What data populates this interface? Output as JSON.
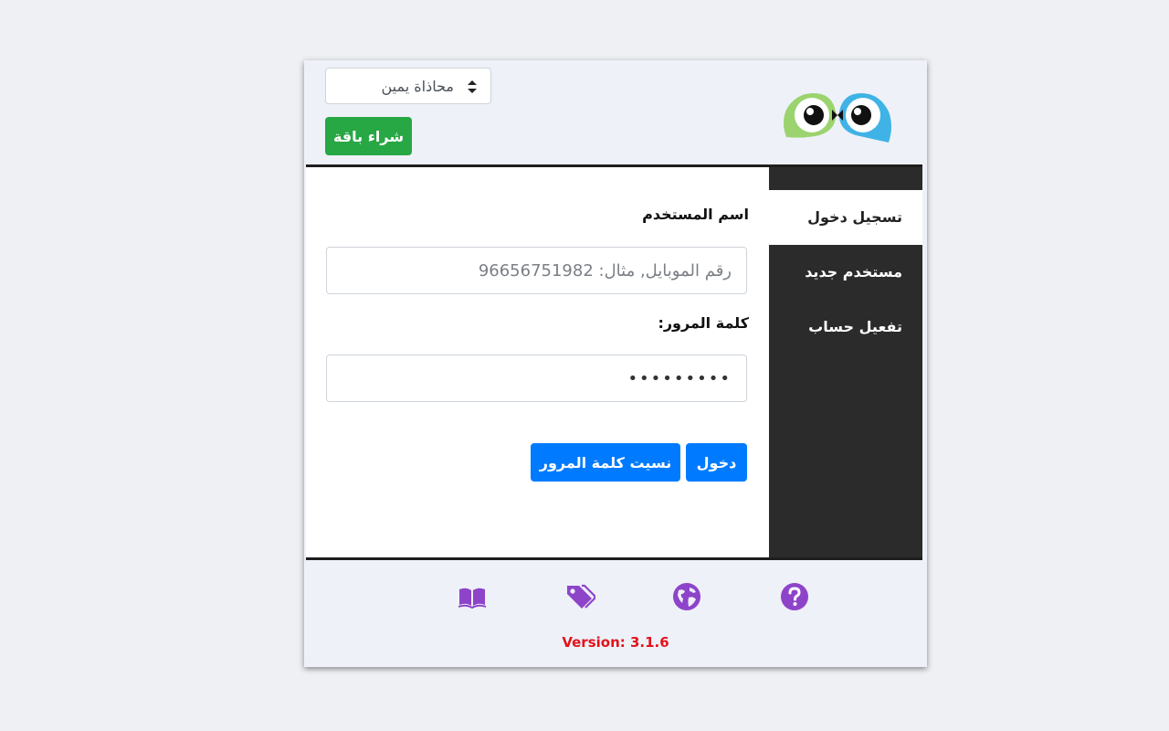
{
  "header": {
    "align_select": {
      "selected": "محاذاة يمين",
      "options": [
        "محاذاة يمين"
      ]
    },
    "buy_label": "شراء باقة"
  },
  "tabs": [
    {
      "label": "تسجيل دخول",
      "active": true
    },
    {
      "label": "مستخدم جديد",
      "active": false
    },
    {
      "label": "تفعيل حساب",
      "active": false
    }
  ],
  "login": {
    "username_label": "اسم المستخدم",
    "username_placeholder": "رقم الموبايل, مثال: 96656751982",
    "username_value": "",
    "password_label": "كلمة المرور:",
    "password_value": "•••••••••",
    "login_button": "دخول",
    "forgot_button": "نسيت كلمة المرور"
  },
  "footer": {
    "icons": [
      "help-icon",
      "globe-icon",
      "tags-icon",
      "book-icon"
    ],
    "version": "Version: 3.1.6"
  },
  "colors": {
    "accent_blue": "#007bff",
    "buy_green": "#28a745",
    "icon_purple": "#8e44c9",
    "version_red": "#e3131b",
    "sidebar_dark": "#2b2b2b"
  }
}
